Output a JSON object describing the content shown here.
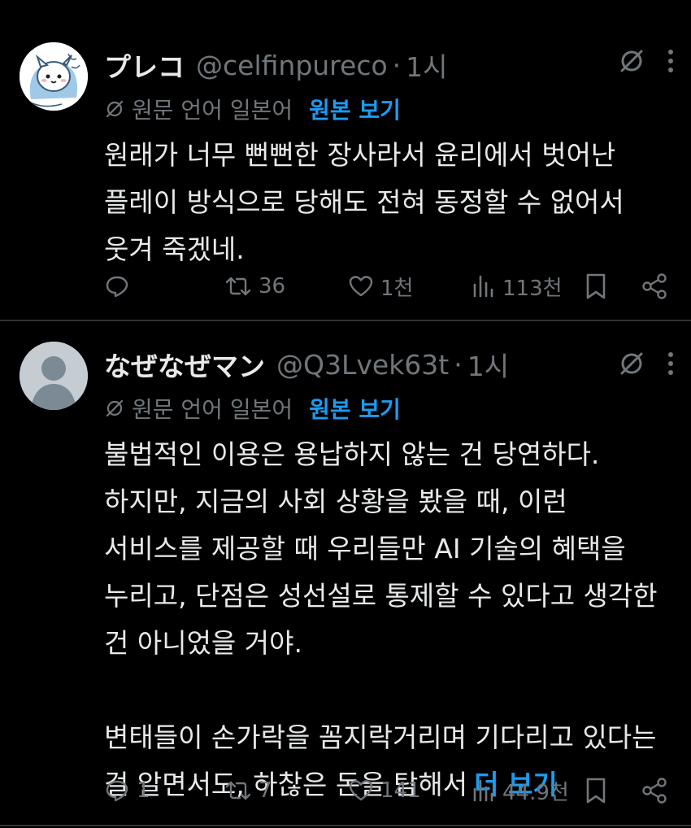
{
  "tweets": [
    {
      "display_name": "プレコ",
      "handle": "@celfinpureco",
      "dot": "·",
      "time": "1시",
      "translate_note": "원문 언어 일본어",
      "show_original": "원본 보기",
      "body_lines": [
        "원래가 너무 뻔뻔한 장사라서 윤리에서 벗어난",
        "플레이 방식으로 당해도 전혀 동정할 수 없어서",
        "웃겨 죽겠네."
      ],
      "replies": "",
      "retweets": "36",
      "likes": "1천",
      "views": "113천"
    },
    {
      "display_name": "なぜなぜマン",
      "handle": "@Q3Lvek63t",
      "dot": "·",
      "time": "1시",
      "translate_note": "원문 언어 일본어",
      "show_original": "원본 보기",
      "body_lines": [
        "불법적인 이용은 용납하지 않는 건 당연하다.",
        "하지만, 지금의 사회 상황을 봤을 때, 이런",
        "서비스를 제공할 때 우리들만 AI 기술의 혜택을",
        "누리고, 단점은 성선설로 통제할 수 있다고 생각한",
        "건 아니었을 거야.",
        "",
        "변태들이 손가락을 꼼지락거리며 기다리고 있다는",
        "걸 알면서도, 하찮은 돈을 탐해서"
      ],
      "more_link": "더 보기",
      "replies": "1",
      "retweets": "7",
      "likes": "141",
      "views": "44.9천"
    }
  ],
  "colors": {
    "background": "#000000",
    "text": "#e7e9ea",
    "muted": "#71767b",
    "link": "#1d9bf0",
    "divider": "#2f3336"
  }
}
